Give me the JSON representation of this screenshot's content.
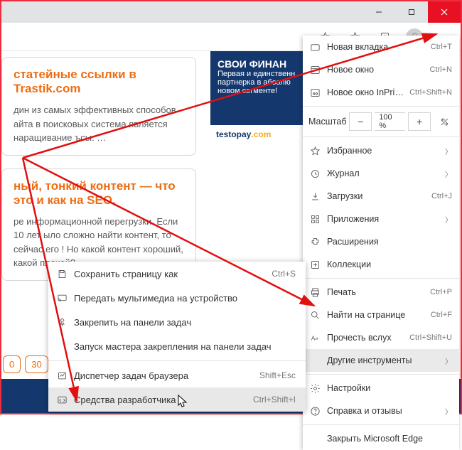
{
  "window": {
    "minimize": "—",
    "maximize": "□",
    "close": "✕"
  },
  "toolbar": {
    "star_icon": "star",
    "fav_icon": "favorites",
    "collections_icon": "collections",
    "avatar": "user",
    "more": "···"
  },
  "page": {
    "card1": {
      "title": "статейные ссылки в Trastik.com",
      "body": "дин из самых эффективных способов айта в поисковых система является наращивание ъсы. …"
    },
    "card2": {
      "title": "ный, тонкий контент — что это и как на SEO.",
      "body": "ре информационной перегрузки. Если 10 лет ыло сложно найти контент, то сейчас его ! Но какой контент хороший, какой плохой? …"
    },
    "pager": [
      "0",
      "30"
    ],
    "ad": {
      "headline": "СВОИ ФИНАН",
      "line1": "Первая и единственн",
      "line2": "партнерка в абсолю",
      "line3": "новом сегменте!",
      "brand_a": "testopay",
      "brand_b": ".com"
    }
  },
  "menu": {
    "new_tab": "Новая вкладка",
    "new_tab_sc": "Ctrl+T",
    "new_window": "Новое окно",
    "new_window_sc": "Ctrl+N",
    "inprivate": "Новое окно InPrivate",
    "inprivate_sc": "Ctrl+Shift+N",
    "zoom_label": "Масштаб",
    "zoom_value": "100 %",
    "favorites": "Избранное",
    "history": "Журнал",
    "downloads": "Загрузки",
    "downloads_sc": "Ctrl+J",
    "apps": "Приложения",
    "extensions": "Расширения",
    "collections": "Коллекции",
    "print": "Печать",
    "print_sc": "Ctrl+P",
    "find": "Найти на странице",
    "find_sc": "Ctrl+F",
    "read_aloud": "Прочесть вслух",
    "read_aloud_sc": "Ctrl+Shift+U",
    "more_tools": "Другие инструменты",
    "settings": "Настройки",
    "help": "Справка и отзывы",
    "close_edge": "Закрыть Microsoft Edge"
  },
  "submenu": {
    "save_as": "Сохранить страницу как",
    "save_as_sc": "Ctrl+S",
    "cast": "Передать мультимедиа на устройство",
    "pin": "Закрепить на панели задач",
    "pin_wizard": "Запуск мастера закрепления на панели задач",
    "task_mgr": "Диспетчер задач браузера",
    "task_mgr_sc": "Shift+Esc",
    "devtools": "Средства разработчика",
    "devtools_sc": "Ctrl+Shift+I"
  }
}
